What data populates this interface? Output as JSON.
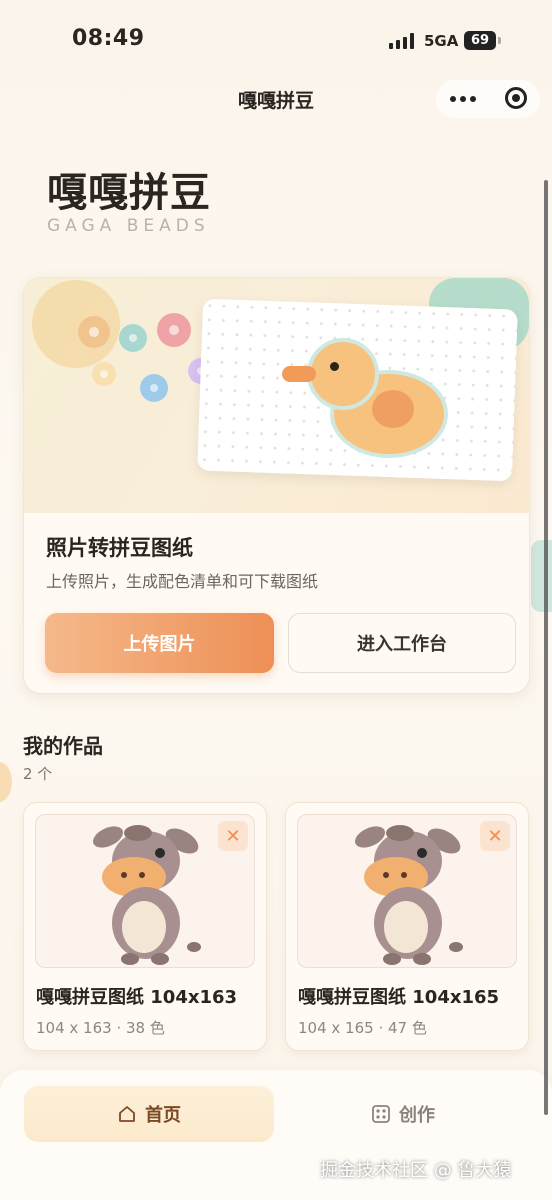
{
  "status_bar": {
    "time": "08:49",
    "network": "5GA",
    "battery": "69"
  },
  "nav": {
    "title": "嘎嘎拼豆"
  },
  "brand": {
    "title": "嘎嘎拼豆",
    "subtitle": "GAGA BEADS"
  },
  "feature_card": {
    "title": "照片转拼豆图纸",
    "description": "上传照片，生成配色清单和可下载图纸",
    "upload_label": "上传图片",
    "workbench_label": "进入工作台"
  },
  "works": {
    "section_title": "我的作品",
    "count": "2 个",
    "items": [
      {
        "name": "嘎嘎拼豆图纸 104x163",
        "meta": "104 x 163 · 38 色",
        "delete": "✕"
      },
      {
        "name": "嘎嘎拼豆图纸 104x165",
        "meta": "104 x 165 · 47 色",
        "delete": "✕"
      }
    ]
  },
  "tabbar": {
    "home_label": "首页",
    "create_label": "创作"
  },
  "watermark": "掘金技术社区 @ 鲁大猿",
  "colors": {
    "accent": "#ee8f56",
    "accent_light": "#f5b98a",
    "mint": "#a9dbc9",
    "background": "#fbf4ea"
  }
}
